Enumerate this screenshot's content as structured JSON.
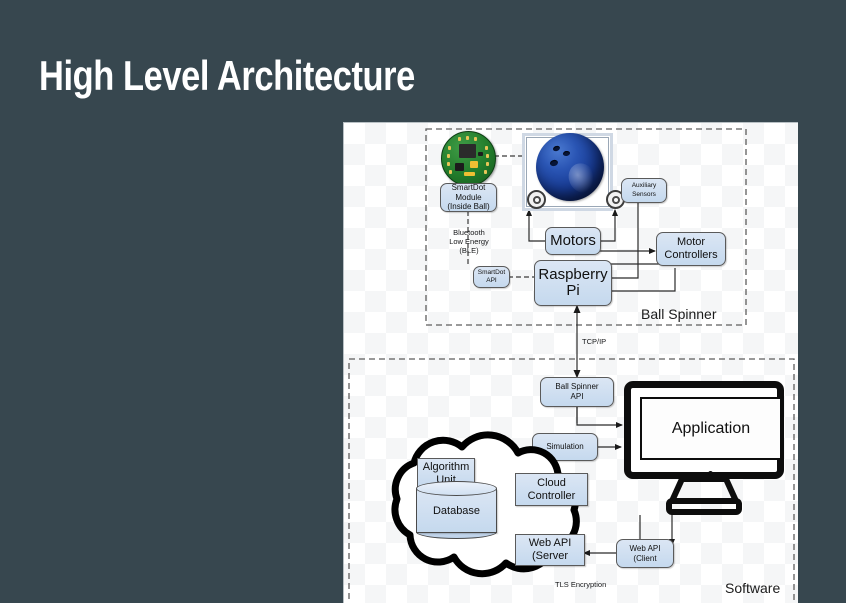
{
  "slide": {
    "title": "High Level Architecture",
    "background_color": "#37474f",
    "title_color": "#ffffff"
  },
  "diagram": {
    "panel_background": "#ffffff",
    "node_fill": "#cddcee",
    "node_border": "#5a5a5a",
    "regions": [
      {
        "name": "ball-spinner",
        "label": "Ball Spinner"
      },
      {
        "name": "software",
        "label": "Software"
      }
    ],
    "nodes": [
      {
        "name": "smartdot-module",
        "label": "SmartDot\nModule\n(Inside Ball)",
        "line1": "SmartDot",
        "line2": "Module",
        "line3": "(Inside Ball)"
      },
      {
        "name": "smartdot-api",
        "label": "SmartDot\nAPI",
        "line1": "SmartDot",
        "line2": "API"
      },
      {
        "name": "motors",
        "label": "Motors"
      },
      {
        "name": "auxiliary-sensors",
        "line1": "Auxiliary",
        "line2": "Sensors"
      },
      {
        "name": "motor-controllers",
        "line1": "Motor",
        "line2": "Controllers"
      },
      {
        "name": "raspberry-pi",
        "line1": "Raspberry",
        "line2": "Pi"
      },
      {
        "name": "ball-spinner-api",
        "line1": "Ball Spinner",
        "line2": "API"
      },
      {
        "name": "simulation",
        "label": "Simulation"
      },
      {
        "name": "application",
        "label": "Application"
      },
      {
        "name": "algorithm-unit",
        "line1": "Algorithm",
        "line2": "Unit"
      },
      {
        "name": "cloud-controller",
        "line1": "Cloud",
        "line2": "Controller"
      },
      {
        "name": "database",
        "label": "Database"
      },
      {
        "name": "web-api-server",
        "line1": "Web API",
        "line2": "(Server"
      },
      {
        "name": "web-api-client",
        "line1": "Web API",
        "line2": "(Client"
      }
    ],
    "edge_labels": [
      {
        "name": "ble-label",
        "line1": "Bluetooth",
        "line2": "Low Energy",
        "line3": "(BLE)"
      },
      {
        "name": "tcpip-label",
        "label": "TCP/IP"
      },
      {
        "name": "tls-label",
        "label": "TLS Encryption"
      }
    ]
  }
}
